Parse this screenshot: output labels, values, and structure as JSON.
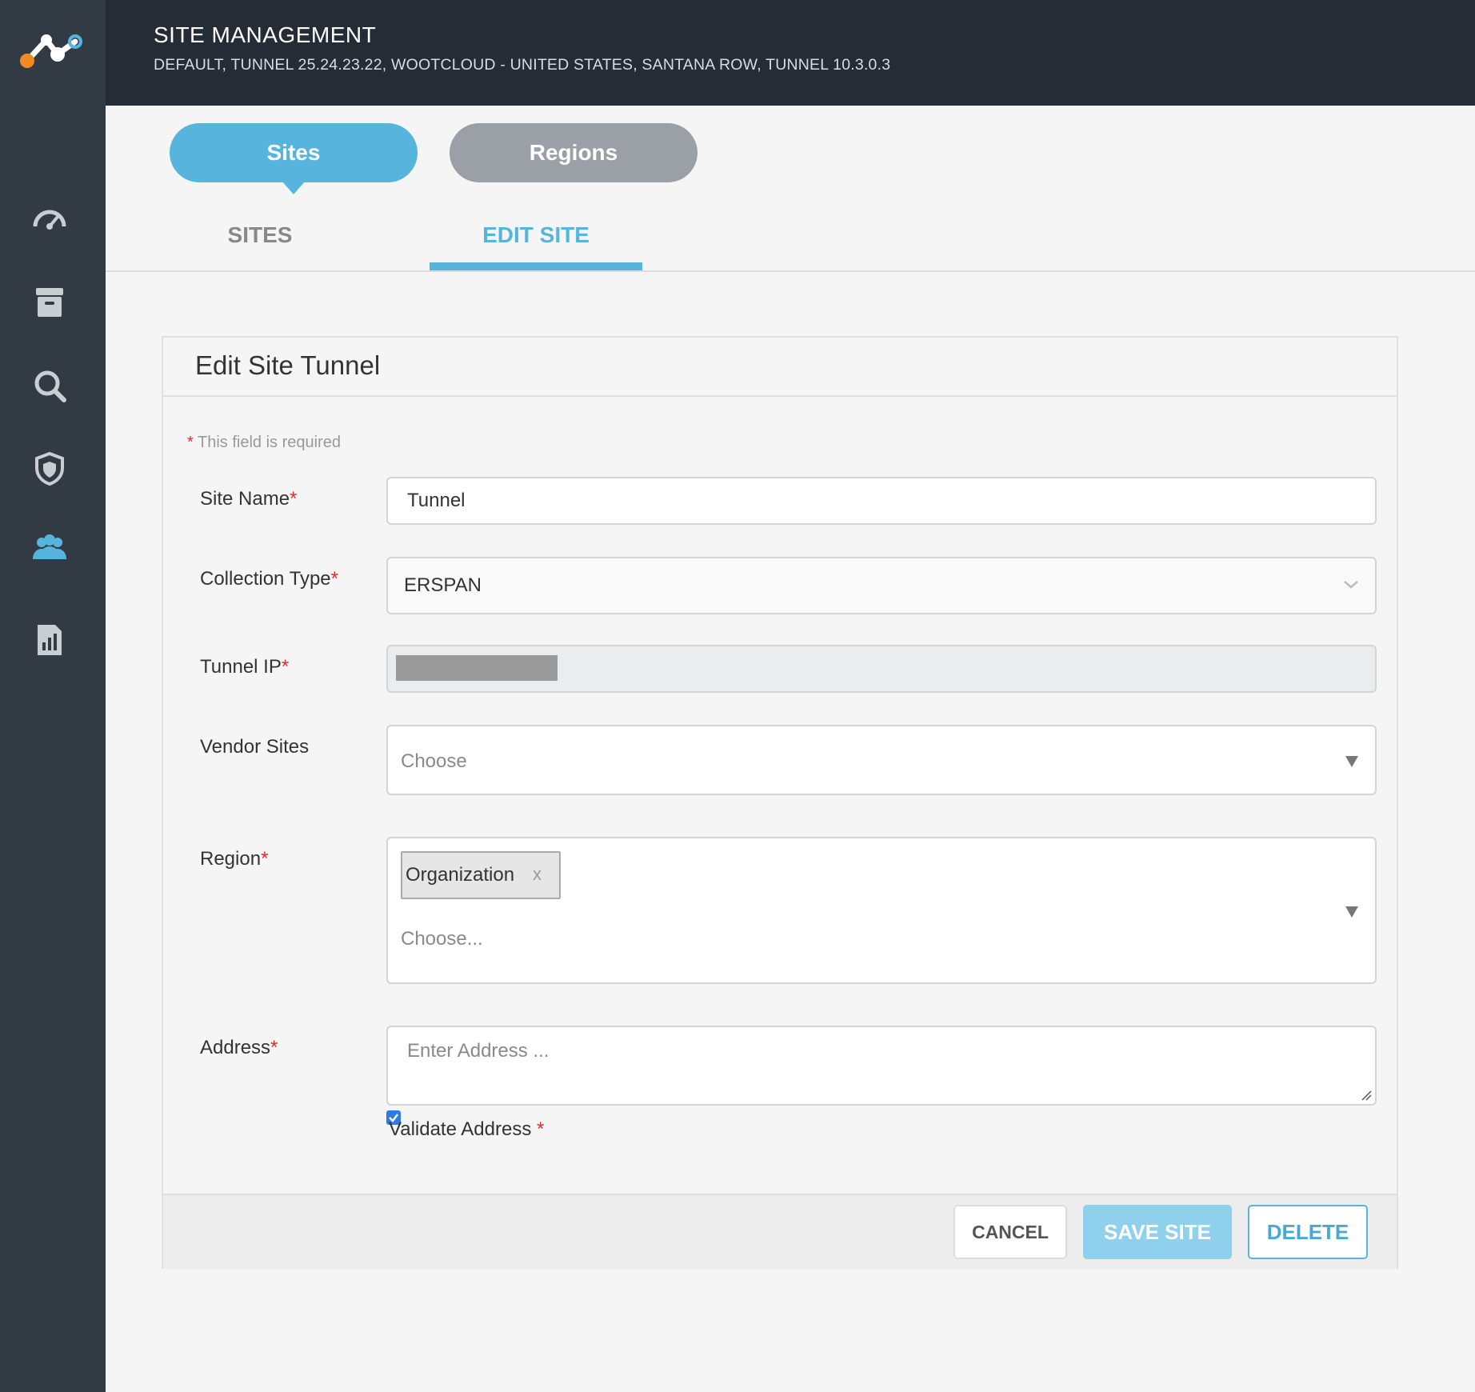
{
  "header": {
    "title": "SITE MANAGEMENT",
    "breadcrumb": "DEFAULT, TUNNEL 25.24.23.22, WOOTCLOUD - UNITED STATES, SANTANA ROW, TUNNEL 10.3.0.3"
  },
  "sidebar": {
    "items": [
      {
        "name": "dashboard",
        "icon": "gauge-icon"
      },
      {
        "name": "inventory",
        "icon": "archive-icon"
      },
      {
        "name": "search",
        "icon": "search-icon"
      },
      {
        "name": "security",
        "icon": "shield-icon"
      },
      {
        "name": "sites",
        "icon": "users-icon",
        "active": true
      },
      {
        "name": "reports",
        "icon": "report-icon"
      }
    ]
  },
  "pills": {
    "sites": "Sites",
    "regions": "Regions"
  },
  "subtabs": {
    "sites": "SITES",
    "edit_site": "EDIT SITE"
  },
  "form": {
    "title": "Edit Site Tunnel",
    "required_star": "*",
    "required_note": "This field is required",
    "site_name": {
      "label": "Site Name",
      "value": "Tunnel"
    },
    "collection_type": {
      "label": "Collection Type",
      "value": "ERSPAN"
    },
    "tunnel_ip": {
      "label": "Tunnel IP"
    },
    "vendor_sites": {
      "label": "Vendor Sites",
      "placeholder": "Choose"
    },
    "region": {
      "label": "Region",
      "tag": "Organization",
      "tag_remove": "x",
      "placeholder": "Choose..."
    },
    "address": {
      "label": "Address",
      "placeholder": "Enter Address ..."
    },
    "validate_address": {
      "label": "Validate Address",
      "checked": true
    }
  },
  "buttons": {
    "cancel": "CANCEL",
    "save": "SAVE SITE",
    "delete": "DELETE"
  },
  "colors": {
    "accent": "#57b5dd",
    "sidebar": "#323b44",
    "header": "#252c35",
    "required": "#d9302c",
    "logo_orange": "#f08a24"
  }
}
